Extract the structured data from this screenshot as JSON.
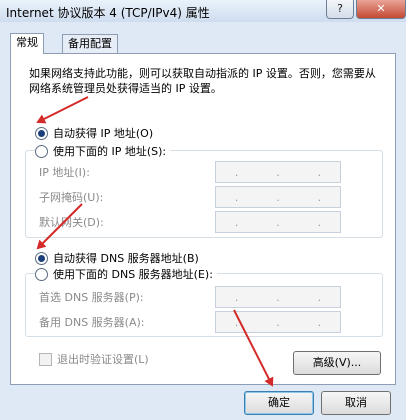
{
  "window": {
    "title": "Internet 协议版本 4 (TCP/IPv4) 属性",
    "help_label": "?",
    "close_label": "✕"
  },
  "tabs": [
    {
      "label": "常规",
      "active": true
    },
    {
      "label": "备用配置",
      "active": false
    }
  ],
  "description": "如果网络支持此功能，则可以获取自动指派的 IP 设置。否则，您需要从网络系统管理员处获得适当的 IP 设置。",
  "ip_section": {
    "auto_label": "自动获得 IP 地址(O)",
    "auto_selected": true,
    "manual_label": "使用下面的 IP 地址(S):",
    "fields": [
      {
        "label": "IP 地址(I):"
      },
      {
        "label": "子网掩码(U):"
      },
      {
        "label": "默认网关(D):"
      }
    ]
  },
  "dns_section": {
    "auto_label": "自动获得 DNS 服务器地址(B)",
    "auto_selected": true,
    "manual_label": "使用下面的 DNS 服务器地址(E):",
    "fields": [
      {
        "label": "首选 DNS 服务器(P):"
      },
      {
        "label": "备用 DNS 服务器(A):"
      }
    ]
  },
  "validate_checkbox": {
    "label": "退出时验证设置(L)",
    "checked": false
  },
  "advanced_button": "高级(V)...",
  "ok_button": "确定",
  "cancel_button": "取消",
  "colors": {
    "arrow": "#d42a2a",
    "window_frame": "#dfe9f5",
    "default_button_border": "#3c7fb1"
  }
}
